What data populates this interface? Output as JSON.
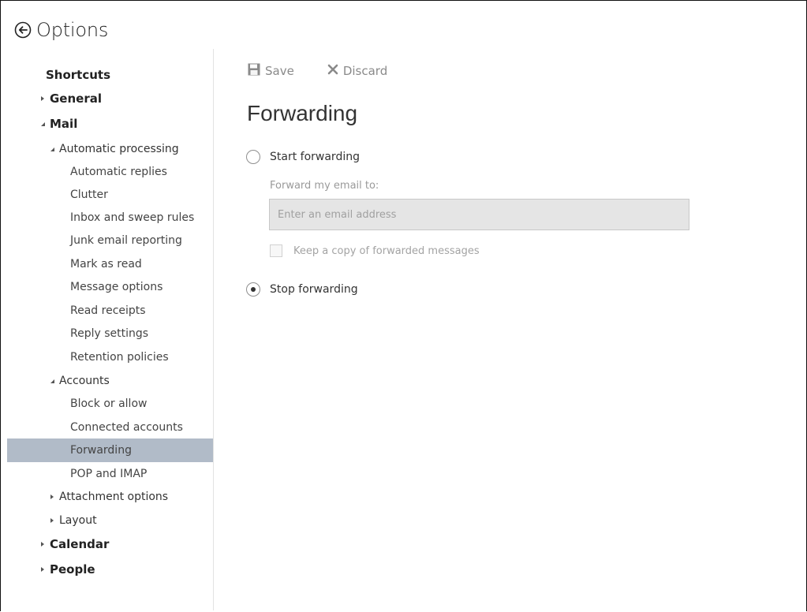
{
  "header": {
    "title": "Options",
    "back_icon": "back-arrow-circle-icon"
  },
  "sidebar": {
    "items": [
      {
        "label": "Shortcuts",
        "level": 0,
        "expander": "none"
      },
      {
        "label": "General",
        "level": 0,
        "expander": "collapsed"
      },
      {
        "label": "Mail",
        "level": 0,
        "expander": "expanded"
      },
      {
        "label": "Automatic processing",
        "level": 1,
        "expander": "expanded"
      },
      {
        "label": "Automatic replies",
        "level": 2,
        "expander": "none"
      },
      {
        "label": "Clutter",
        "level": 2,
        "expander": "none"
      },
      {
        "label": "Inbox and sweep rules",
        "level": 2,
        "expander": "none"
      },
      {
        "label": "Junk email reporting",
        "level": 2,
        "expander": "none"
      },
      {
        "label": "Mark as read",
        "level": 2,
        "expander": "none"
      },
      {
        "label": "Message options",
        "level": 2,
        "expander": "none"
      },
      {
        "label": "Read receipts",
        "level": 2,
        "expander": "none"
      },
      {
        "label": "Reply settings",
        "level": 2,
        "expander": "none"
      },
      {
        "label": "Retention policies",
        "level": 2,
        "expander": "none"
      },
      {
        "label": "Accounts",
        "level": 1,
        "expander": "expanded"
      },
      {
        "label": "Block or allow",
        "level": 2,
        "expander": "none"
      },
      {
        "label": "Connected accounts",
        "level": 2,
        "expander": "none"
      },
      {
        "label": "Forwarding",
        "level": 2,
        "expander": "none",
        "selected": true
      },
      {
        "label": "POP and IMAP",
        "level": 2,
        "expander": "none"
      },
      {
        "label": "Attachment options",
        "level": 1,
        "expander": "collapsed"
      },
      {
        "label": "Layout",
        "level": 1,
        "expander": "collapsed"
      },
      {
        "label": "Calendar",
        "level": 0,
        "expander": "collapsed"
      },
      {
        "label": "People",
        "level": 0,
        "expander": "collapsed"
      }
    ]
  },
  "toolbar": {
    "save_label": "Save",
    "save_icon": "floppy-disk-icon",
    "discard_label": "Discard",
    "discard_icon": "x-icon"
  },
  "main": {
    "section_title": "Forwarding",
    "start_forwarding_label": "Start forwarding",
    "start_forwarding_checked": false,
    "forward_to_label": "Forward my email to:",
    "email_placeholder": "Enter an email address",
    "email_value": "",
    "keep_copy_label": "Keep a copy of forwarded messages",
    "keep_copy_checked": false,
    "stop_forwarding_label": "Stop forwarding",
    "stop_forwarding_checked": true
  },
  "colors": {
    "selected_bg": "#b1bbc8",
    "disabled_text": "#9a9a9a",
    "input_bg": "#e5e5e5"
  }
}
